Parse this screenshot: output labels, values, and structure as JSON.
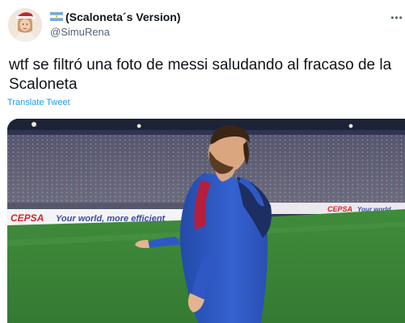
{
  "author": {
    "display_name": "(Scaloneta´s Version)",
    "handle": "@SimuRena"
  },
  "tweet": {
    "text": "wtf se filtró una foto de messi saludando al fracaso de la Scaloneta",
    "translate_label": "Translate Tweet"
  },
  "media": {
    "ad_board_left": "CEPSA",
    "ad_board_slogan": "Your world, more efficient",
    "ad_board_right_brand": "CEPSA",
    "ad_board_right_slogan": "Your world"
  },
  "icons": {
    "flag": "argentina-flag-icon",
    "more": "more-options-icon"
  },
  "colors": {
    "link": "#1d9bf0",
    "secondary_text": "#536471",
    "jersey_blue": "#2f58c4",
    "ad_red": "#d4252a",
    "pitch_green": "#3e8a3c"
  }
}
